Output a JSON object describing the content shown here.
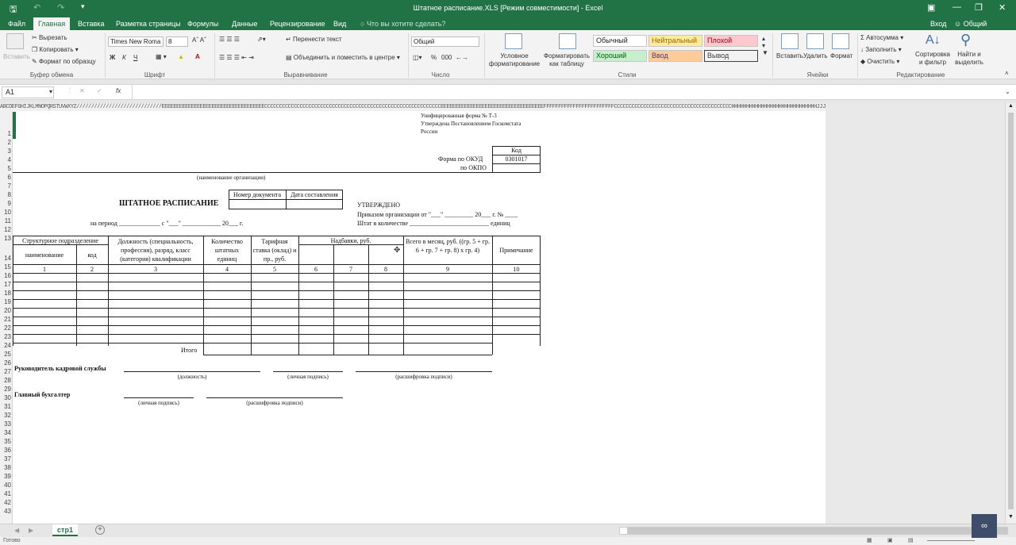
{
  "window": {
    "title": "Штатное расписание.XLS  [Режим совместимости]  -  Excel"
  },
  "menu": {
    "file": "Файл",
    "home": "Главная",
    "insert": "Вставка",
    "layout": "Разметка страницы",
    "formulas": "Формулы",
    "data": "Данные",
    "review": "Рецензирование",
    "view": "Вид",
    "tell": "Что вы хотите сделать?",
    "login": "Вход",
    "share": "Общий доступ"
  },
  "ribbon": {
    "paste": "Вставить",
    "cut": "Вырезать",
    "copy": "Копировать",
    "format_painter": "Формат по образцу",
    "clipboard_group": "Буфер обмена",
    "font_name": "Times New Roma",
    "font_size": "8",
    "bold": "Ж",
    "italic": "К",
    "underline": "Ч",
    "font_group": "Шрифт",
    "wrap": "Перенести текст",
    "merge": "Объединить и поместить в центре",
    "align_group": "Выравнивание",
    "number_format": "Общий",
    "percent": "%",
    "thousands": "000",
    "number_group": "Число",
    "cond_format": "Условное форматирование",
    "format_table": "Форматировать как таблицу",
    "styles": {
      "normal": "Обычный",
      "neutral": "Нейтральный",
      "bad": "Плохой",
      "good": "Хороший",
      "input": "Ввод",
      "output": "Вывод"
    },
    "styles_group": "Стили",
    "insert": "Вставить",
    "delete": "Удалить",
    "format": "Формат",
    "cells_group": "Ячейки",
    "autosum": "Автосумма",
    "fill": "Заполнить",
    "clear": "Очистить",
    "sort": "Сортировка и фильтр",
    "find": "Найти и выделить",
    "edit_group": "Редактирование"
  },
  "formula_bar": {
    "name_box": "A1",
    "fx": "fx",
    "value": ""
  },
  "column_header": "ABCDEFGHIJKLMNOPQRSTUVWXYZ/////////////////////////////EEEEEEEEEEEEEEEEEEEEEEEEEEEEEEEEEEECCCCCCCCCCCCCCCCCCCCCCCCCCCCCCCCCCCCCCCCCCCCCCCCCCCCCCCCCCCCEEEEEEEEEEEEEEEEEEEEEEEEEEEEEEEEEEEFFFFFFFFFFFFFFFFFFFFFFFFCCCCCCCCCCCCCCCCCCCCCCCCCCCCCCCCCCCCCCCCHHHHHHHHHHHHHHHHHHHHHHHHHHHHHJJJJJJJJJJJJJJJJJJJJ",
  "rows": [
    "1",
    "2",
    "3",
    "4",
    "5",
    "6",
    "7",
    "8",
    "9",
    "10",
    "11",
    "12",
    "13",
    "14",
    "15",
    "16",
    "17",
    "18",
    "19",
    "20",
    "21",
    "22",
    "23",
    "24",
    "25",
    "26",
    "27",
    "28",
    "29",
    "30",
    "31",
    "32",
    "33",
    "34",
    "35",
    "36",
    "37",
    "38",
    "39",
    "40",
    "41",
    "42",
    "43"
  ],
  "form": {
    "header_line1": "Унифицированная форма № Т-3",
    "header_line2": "Утверждена Постановлением Госкомстата",
    "header_line3": "России",
    "code_label": "Код",
    "okud_label": "Форма по ОКУД",
    "okud_value": "0301017",
    "okpo_label": "по ОКПО",
    "org_caption": "(наименование организации)",
    "doc_number": "Номер документа",
    "doc_date": "Дата составления",
    "title": "ШТАТНОЕ РАСПИСАНИЕ",
    "approved": "УТВЕРЖДЕНО",
    "order_line": "Приказом организации от \"___\" _________ 20___ г. № ____",
    "staff_line": "Штат в количестве _________________________ единиц",
    "period_line": "на период _____________ с \"___\" ____________ 20___ г.",
    "col_dept": "Структурное подразделение",
    "col_name": "наименование",
    "col_code": "код",
    "col_position": "Должность (специальность, профессия), разряд, класс (категория) квалификации",
    "col_count": "Количество штатных единиц",
    "col_rate": "Тарифная ставка (оклад) и пр., руб.",
    "col_bonus": "Надбавки, руб.",
    "col_total": "Всего в месяц, руб. ((гр. 5 + гр. 6 + гр. 7 + гр. 8) x гр. 4)",
    "col_note": "Примечание",
    "nums": [
      "1",
      "2",
      "3",
      "4",
      "5",
      "6",
      "7",
      "8",
      "9",
      "10"
    ],
    "itogo": "Итого",
    "hr_head": "Руководитель кадровой службы",
    "cap_position": "(должность)",
    "cap_signature": "(личная подпись)",
    "cap_decode": "(расшифровка подписи)",
    "accountant": "Главный бухгалтер",
    "cap_signature2": "(личная подпись)",
    "cap_decode2": "(расшифровка подписи)"
  },
  "sheet_tab": "стр1",
  "status": "Готово"
}
